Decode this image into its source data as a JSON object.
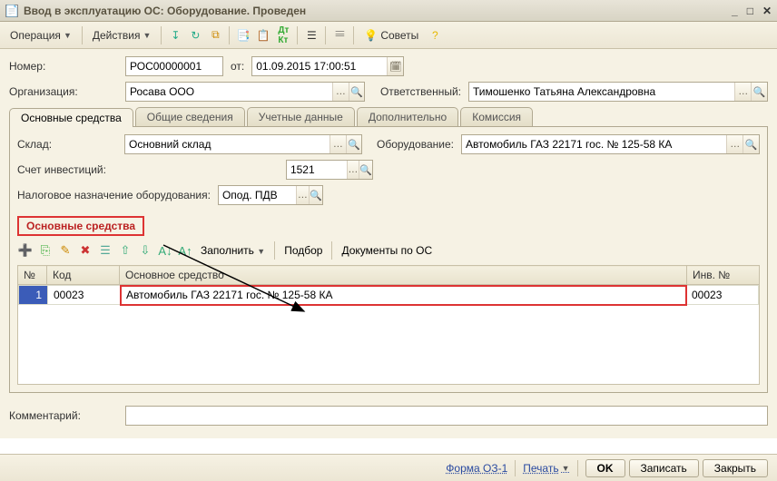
{
  "window": {
    "title": "Ввод в эксплуатацию ОС: Оборудование. Проведен"
  },
  "toolbar": {
    "operation": "Операция",
    "actions": "Действия",
    "advice": "Советы"
  },
  "form": {
    "number_label": "Номер:",
    "number_value": "РОС00000001",
    "from_label": "от:",
    "date_value": "01.09.2015 17:00:51",
    "org_label": "Организация:",
    "org_value": "Росава ООО",
    "responsible_label": "Ответственный:",
    "responsible_value": "Тимошенко Татьяна Александровна",
    "warehouse_label": "Склад:",
    "warehouse_value": "Основний склад",
    "equipment_label": "Оборудование:",
    "equipment_value": "Автомобиль ГАЗ 22171 гос. № 125-58 КА",
    "invest_account_label": "Счет инвестиций:",
    "invest_account_value": "1521",
    "tax_label": "Налоговое назначение оборудования:",
    "tax_value": "Опод. ПДВ",
    "comment_label": "Комментарий:",
    "comment_value": ""
  },
  "tabs": {
    "t0": "Основные средства",
    "t1": "Общие сведения",
    "t2": "Учетные данные",
    "t3": "Дополнительно",
    "t4": "Комиссия"
  },
  "section_title": "Основные средства",
  "grid_toolbar": {
    "fill": "Заполнить",
    "select": "Подбор",
    "docs": "Документы по ОС"
  },
  "grid": {
    "headers": {
      "num": "№",
      "code": "Код",
      "asset": "Основное средство",
      "inv": "Инв. №"
    },
    "rows": [
      {
        "num": "1",
        "code": "00023",
        "asset": "Автомобиль ГАЗ 22171 гос. № 125-58 КА",
        "inv": "00023"
      }
    ]
  },
  "footer": {
    "form_oz": "Форма ОЗ-1",
    "print": "Печать",
    "ok": "OK",
    "save": "Записать",
    "close": "Закрыть"
  }
}
